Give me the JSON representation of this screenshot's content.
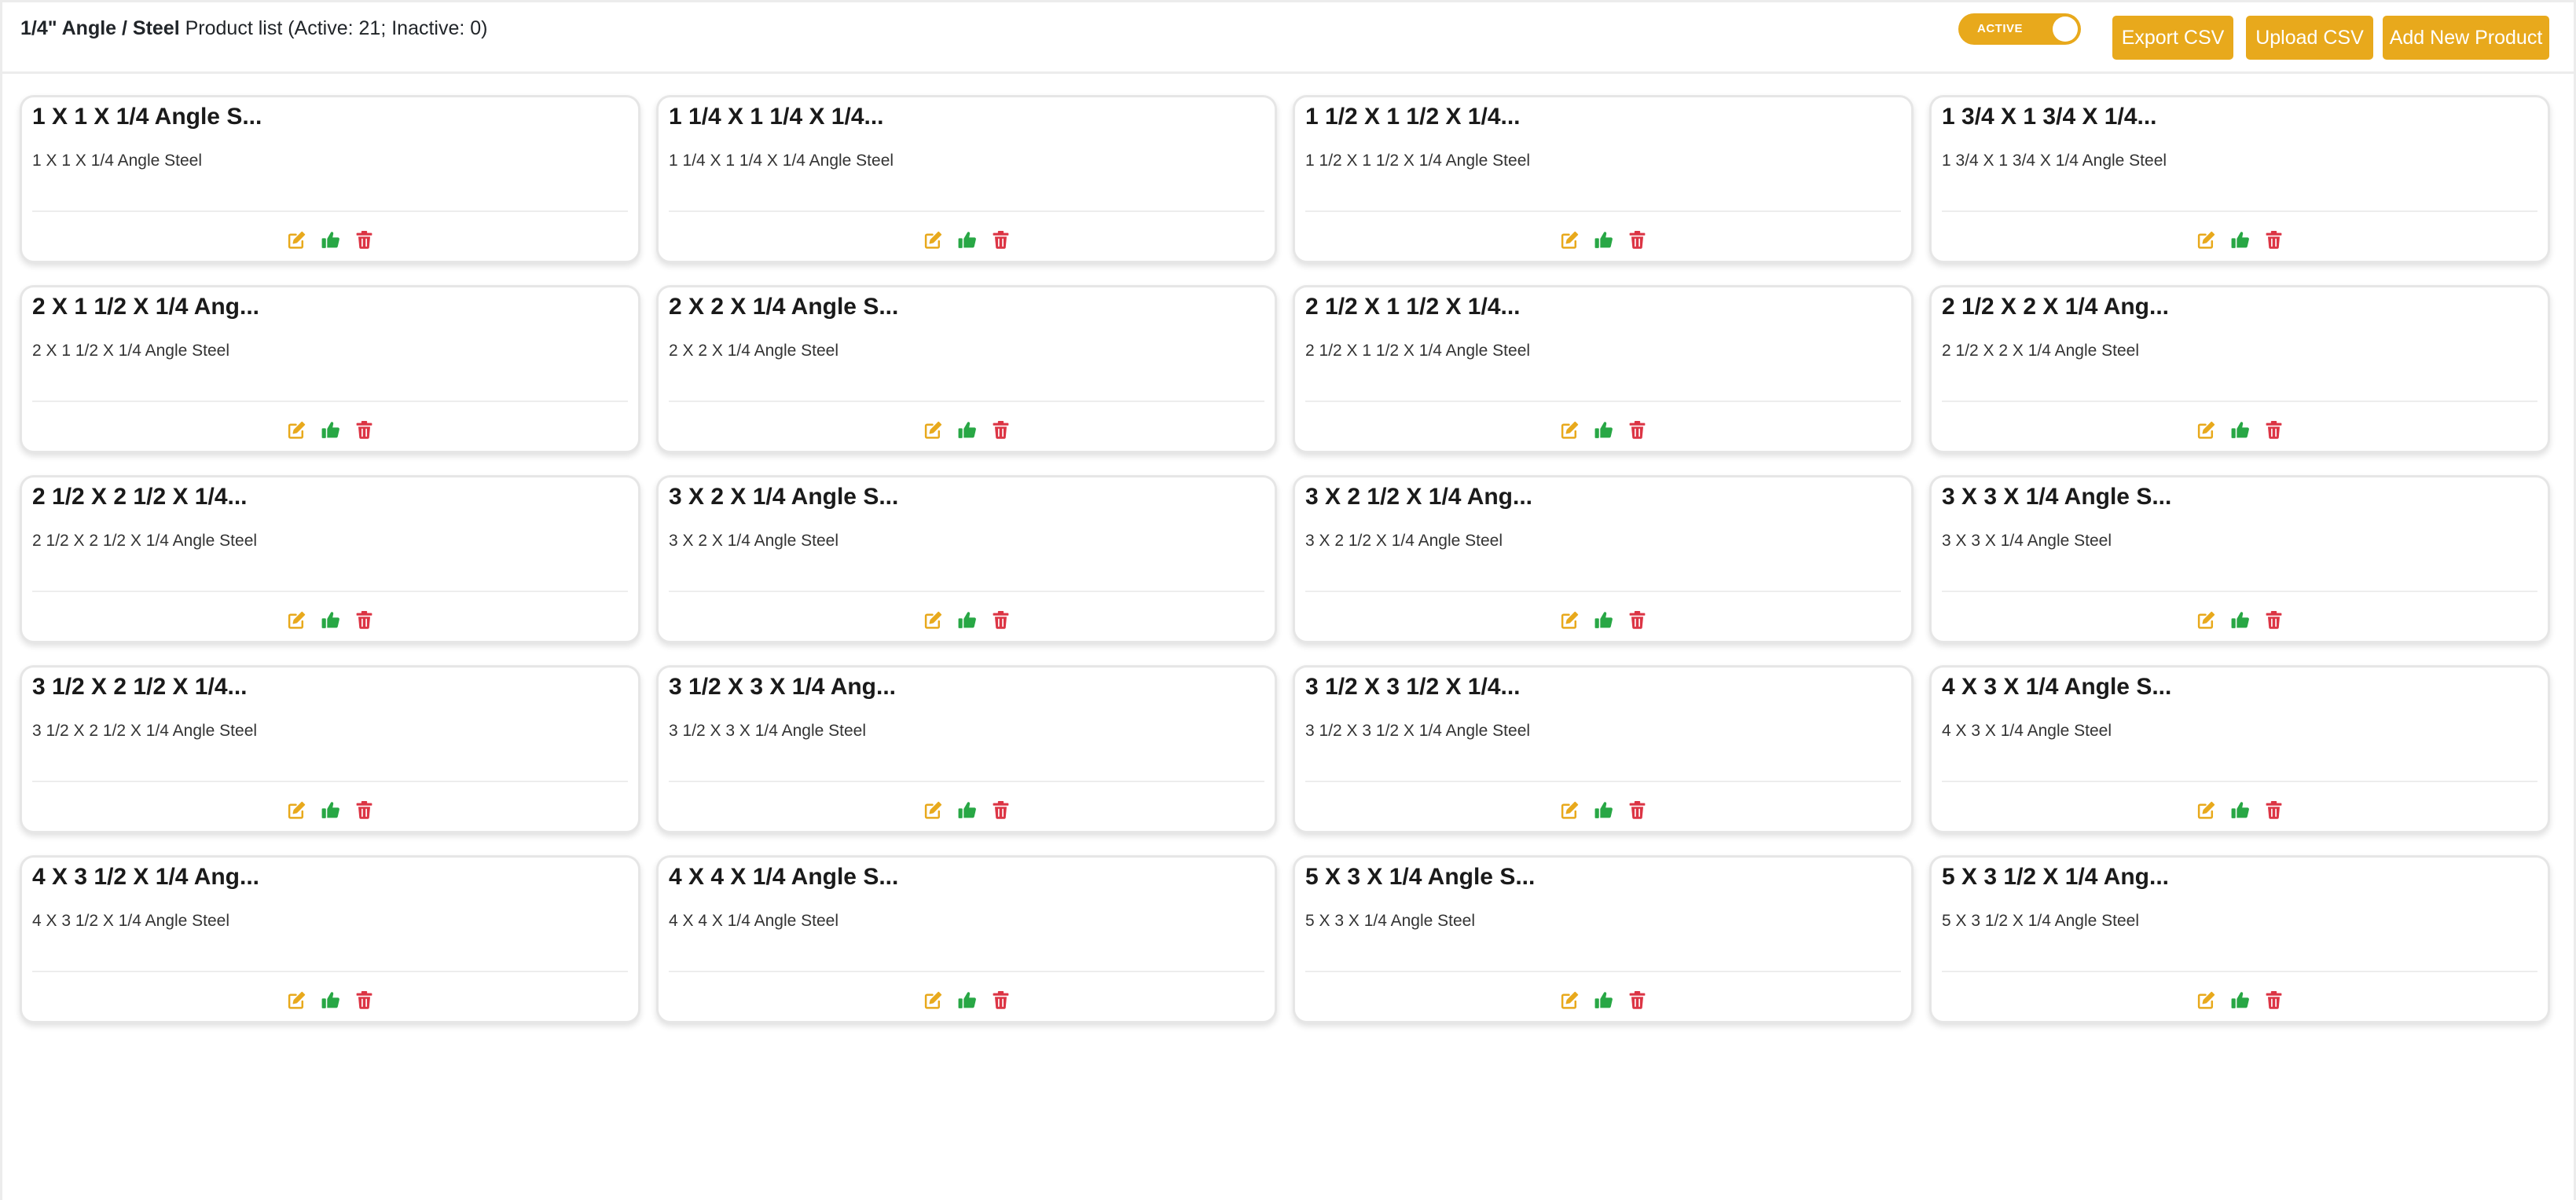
{
  "header": {
    "category": "1/4\" Angle / Steel",
    "list_label": "Product list (Active: 21; Inactive: 0)"
  },
  "toggle": {
    "label": "ACTIVE",
    "on": true
  },
  "toolbar": {
    "export_label": "Export CSV",
    "upload_label": "Upload CSV",
    "add_label": "Add New Product"
  },
  "colors": {
    "accent": "#e8a91c",
    "approve": "#28a745",
    "delete": "#dc3545"
  },
  "icons": {
    "edit": "edit-icon",
    "approve": "thumbs-up-icon",
    "delete": "trash-icon"
  },
  "products": [
    {
      "title": "1 X 1 X 1/4 Angle S...",
      "description": "1 X 1 X 1/4 Angle Steel"
    },
    {
      "title": "1 1/4 X 1 1/4 X 1/4...",
      "description": "1 1/4 X 1 1/4 X 1/4 Angle Steel"
    },
    {
      "title": "1 1/2 X 1 1/2 X 1/4...",
      "description": "1 1/2 X 1 1/2 X 1/4 Angle Steel"
    },
    {
      "title": "1 3/4 X 1 3/4 X 1/4...",
      "description": "1 3/4 X 1 3/4 X 1/4 Angle Steel"
    },
    {
      "title": "2 X 1 1/2 X 1/4 Ang...",
      "description": "2 X 1 1/2 X 1/4 Angle Steel"
    },
    {
      "title": "2 X 2 X 1/4 Angle S...",
      "description": "2 X 2 X 1/4 Angle Steel"
    },
    {
      "title": "2 1/2 X 1 1/2 X 1/4...",
      "description": "2 1/2 X 1 1/2 X 1/4 Angle Steel"
    },
    {
      "title": "2 1/2 X 2 X 1/4 Ang...",
      "description": "2 1/2 X 2 X 1/4 Angle Steel"
    },
    {
      "title": "2 1/2 X 2 1/2 X 1/4...",
      "description": "2 1/2 X 2 1/2 X 1/4 Angle Steel"
    },
    {
      "title": "3 X 2 X 1/4 Angle S...",
      "description": "3 X 2 X 1/4 Angle Steel"
    },
    {
      "title": "3 X 2 1/2 X 1/4 Ang...",
      "description": "3 X 2 1/2 X 1/4 Angle Steel"
    },
    {
      "title": "3 X 3 X 1/4 Angle S...",
      "description": "3 X 3 X 1/4 Angle Steel"
    },
    {
      "title": "3 1/2 X 2 1/2 X 1/4...",
      "description": "3 1/2 X 2 1/2 X 1/4 Angle Steel"
    },
    {
      "title": "3 1/2 X 3 X 1/4 Ang...",
      "description": "3 1/2 X 3 X 1/4 Angle Steel"
    },
    {
      "title": "3 1/2 X 3 1/2 X 1/4...",
      "description": "3 1/2 X 3 1/2 X 1/4 Angle Steel"
    },
    {
      "title": "4 X 3 X 1/4 Angle S...",
      "description": "4 X 3 X 1/4 Angle Steel"
    },
    {
      "title": "4 X 3 1/2 X 1/4 Ang...",
      "description": "4 X 3 1/2 X 1/4 Angle Steel"
    },
    {
      "title": "4 X 4 X 1/4 Angle S...",
      "description": "4 X 4 X 1/4 Angle Steel"
    },
    {
      "title": "5 X 3 X 1/4 Angle S...",
      "description": "5 X 3 X 1/4 Angle Steel"
    },
    {
      "title": "5 X 3 1/2 X 1/4 Ang...",
      "description": "5 X 3 1/2 X 1/4 Angle Steel"
    }
  ]
}
